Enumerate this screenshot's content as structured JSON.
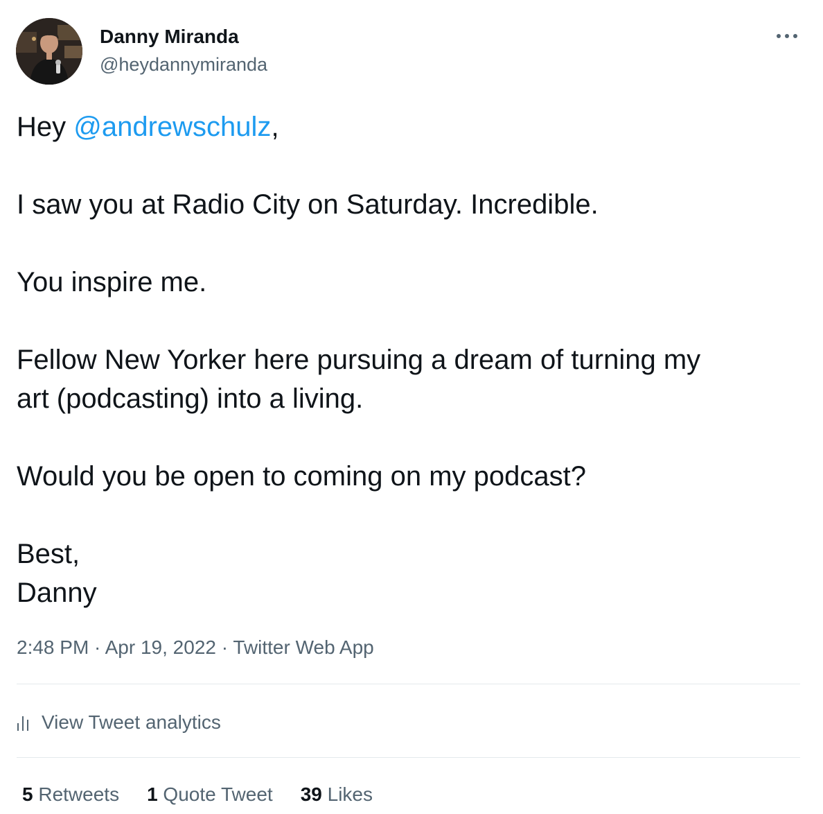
{
  "author": {
    "display_name": "Danny Miranda",
    "handle": "@heydannymiranda",
    "avatar_icon": "profile-photo-avatar"
  },
  "more_icon": "more-dots-icon",
  "tweet": {
    "greeting_prefix": "Hey ",
    "mention": "@andrewschulz",
    "greeting_suffix": ",",
    "line1": "I saw you at Radio City on Saturday. Incredible.",
    "line2": "You inspire me.",
    "line3a": "Fellow New Yorker here pursuing a dream of turning my",
    "line3b": "art (podcasting) into a living.",
    "line4": "Would you be open to coming on my podcast?",
    "signoff1": "Best,",
    "signoff2": "Danny"
  },
  "meta": {
    "time": "2:48 PM",
    "separator": " · ",
    "date": "Apr 19, 2022",
    "source": "Twitter Web App"
  },
  "analytics": {
    "icon": "analytics-bars-icon",
    "label": "View Tweet analytics"
  },
  "stats": {
    "retweets_count": "5",
    "retweets_label": " Retweets",
    "quotes_count": "1",
    "quotes_label": " Quote Tweet",
    "likes_count": "39",
    "likes_label": " Likes"
  },
  "colors": {
    "link": "#1d9bf0",
    "secondary_text": "#536471",
    "primary_text": "#0f1419",
    "divider": "#e4e9ec"
  }
}
